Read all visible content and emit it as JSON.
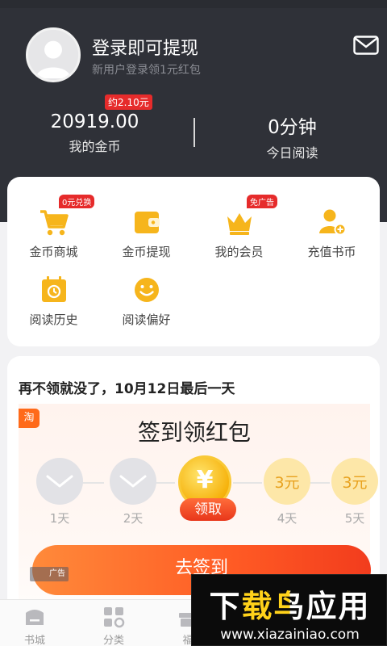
{
  "header": {
    "login_title": "登录即可提现",
    "login_subtitle": "新用户登录领1元红包",
    "coins_badge": "约2.10元",
    "coins_value": "20919.00",
    "coins_label": "我的金币",
    "reading_value": "0分钟",
    "reading_label": "今日阅读"
  },
  "menu": {
    "items": [
      {
        "label": "金币商城",
        "icon": "cart-icon",
        "badge": "0元兑换"
      },
      {
        "label": "金币提现",
        "icon": "wallet-icon"
      },
      {
        "label": "我的会员",
        "icon": "crown-icon",
        "badge": "免广告"
      },
      {
        "label": "充值书币",
        "icon": "user-plus-icon"
      },
      {
        "label": "阅读历史",
        "icon": "calendar-history-icon"
      },
      {
        "label": "阅读偏好",
        "icon": "smile-icon"
      }
    ]
  },
  "sign": {
    "headline": "再不领就没了，10月12日最后一天",
    "taobao_tag": "淘",
    "promo_title": "签到领红包",
    "claim_label": "领取",
    "go_button": "去签到",
    "ad_tag": "广告",
    "coin_symbol": "¥",
    "days": [
      {
        "label": "1天",
        "state": "done"
      },
      {
        "label": "2天",
        "state": "done"
      },
      {
        "label": "3天",
        "state": "current"
      },
      {
        "label": "4天",
        "state": "pending",
        "reward": "3元"
      },
      {
        "label": "5天",
        "state": "pending",
        "reward": "3元"
      }
    ]
  },
  "tabs": [
    {
      "label": "书城",
      "icon": "bookstore-icon"
    },
    {
      "label": "分类",
      "icon": "category-icon"
    },
    {
      "label": "福",
      "icon": "welfare-icon"
    }
  ],
  "watermark": {
    "title": "下载鸟应用",
    "url": "www.xiazainiao.com"
  },
  "colors": {
    "header_bg": "#2f3138",
    "accent_red": "#e62b2b",
    "accent_orange": "#ff5a24",
    "icon_yellow": "#f6b51c"
  }
}
